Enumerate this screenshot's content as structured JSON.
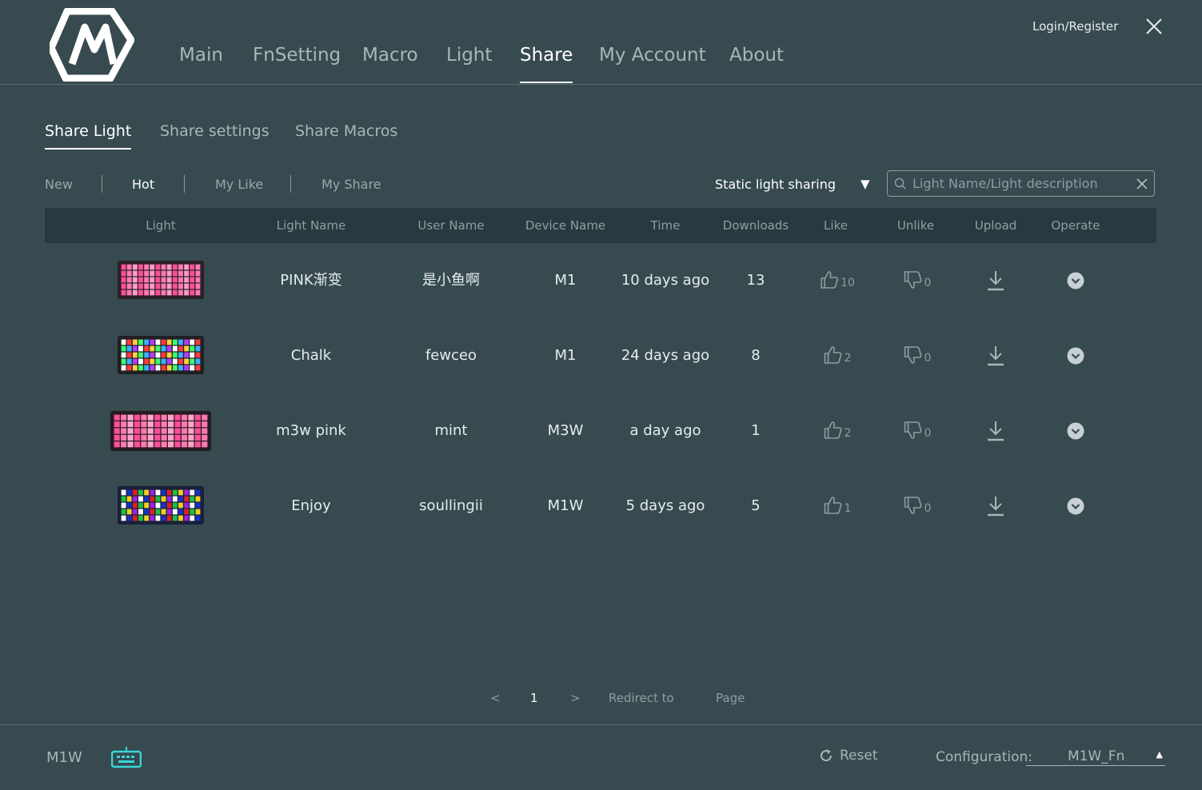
{
  "header": {
    "nav": [
      "Main",
      "FnSetting",
      "Macro",
      "Light",
      "Share",
      "My Account",
      "About"
    ],
    "active_nav": "Share",
    "login_label": "Login/Register"
  },
  "share_tabs": [
    "Share Light",
    "Share settings",
    "Share Macros"
  ],
  "filters": [
    "New",
    "Hot",
    "My Like",
    "My Share"
  ],
  "active_filter": "Hot",
  "dropdown": {
    "selected": "Static light sharing"
  },
  "search": {
    "placeholder": "Light Name/Light description",
    "value": ""
  },
  "table": {
    "columns": [
      "Light",
      "Light Name",
      "User Name",
      "Device Name",
      "Time",
      "Downloads",
      "Like",
      "Unlike",
      "Upload",
      "Operate"
    ],
    "rows": [
      {
        "light_name": "PINK渐变",
        "user_name": "是小鱼啊",
        "device": "M1",
        "time": "10 days ago",
        "downloads": "13",
        "likes": "10",
        "unlikes": "0",
        "thumb": "pink"
      },
      {
        "light_name": "Chalk",
        "user_name": "fewceo",
        "device": "M1",
        "time": "24 days ago",
        "downloads": "8",
        "likes": "2",
        "unlikes": "0",
        "thumb": "chalk"
      },
      {
        "light_name": "m3w pink",
        "user_name": "mint",
        "device": "M3W",
        "time": "a day ago",
        "downloads": "1",
        "likes": "2",
        "unlikes": "0",
        "thumb": "pink-wide"
      },
      {
        "light_name": "Enjoy",
        "user_name": "soullingii",
        "device": "M1W",
        "time": "5 days ago",
        "downloads": "5",
        "likes": "1",
        "unlikes": "0",
        "thumb": "enjoy"
      }
    ]
  },
  "pagination": {
    "prev": "<",
    "current": "1",
    "next": ">",
    "redirect_label": "Redirect to",
    "page_label": "Page"
  },
  "footer": {
    "device": "M1W",
    "reset_label": "Reset",
    "config_label": "Configuration:",
    "config_value": "M1W_Fn"
  },
  "colors": {
    "background": "#364a50",
    "table_header": "#273a40",
    "keyboard_icon": "#3ad6d6"
  }
}
